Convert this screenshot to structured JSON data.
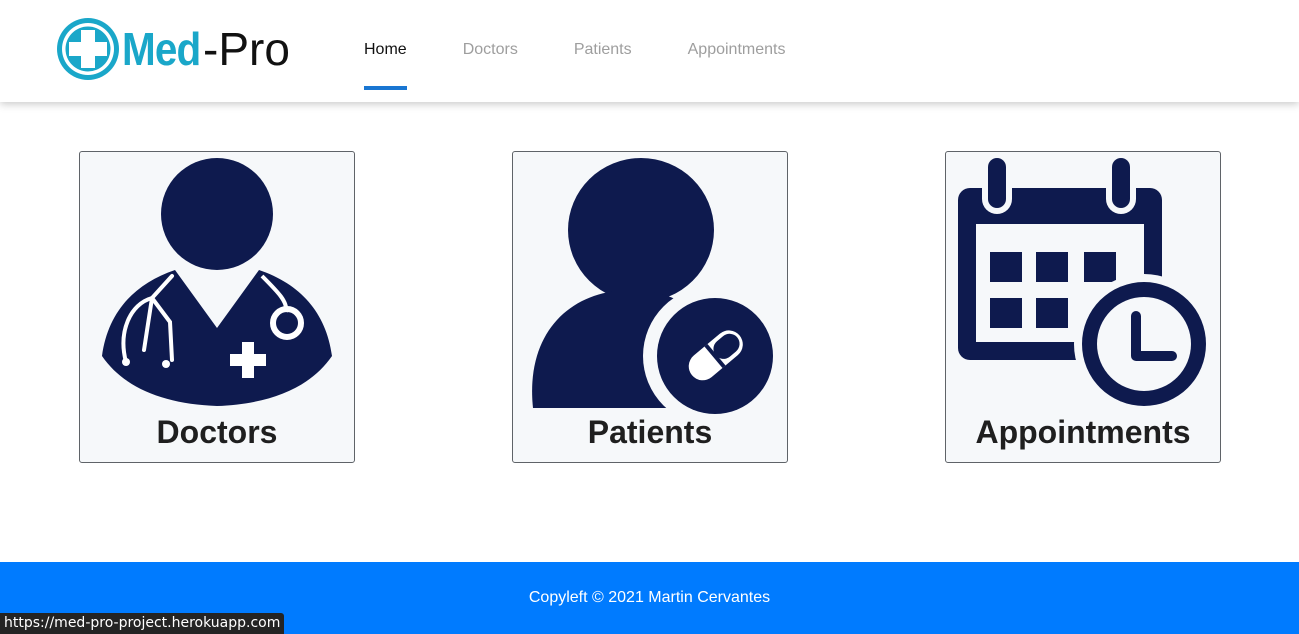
{
  "brand": {
    "name_part1": "Med",
    "name_part2": "-Pro",
    "accent_color": "#1aa7c9",
    "icon": "medical-cross-icon"
  },
  "nav": {
    "items": [
      {
        "label": "Home",
        "active": true
      },
      {
        "label": "Doctors",
        "active": false
      },
      {
        "label": "Patients",
        "active": false
      },
      {
        "label": "Appointments",
        "active": false
      }
    ],
    "active_color": "#1976d2"
  },
  "cards": [
    {
      "label": "Doctors",
      "icon": "doctor-icon"
    },
    {
      "label": "Patients",
      "icon": "patient-icon"
    },
    {
      "label": "Appointments",
      "icon": "calendar-clock-icon"
    }
  ],
  "icon_color": "#0e1a4e",
  "footer": {
    "text": "Copyleft © 2021 Martin Cervantes",
    "color": "#007bff"
  },
  "status_bar": {
    "url": "https://med-pro-project.herokuapp.com"
  }
}
